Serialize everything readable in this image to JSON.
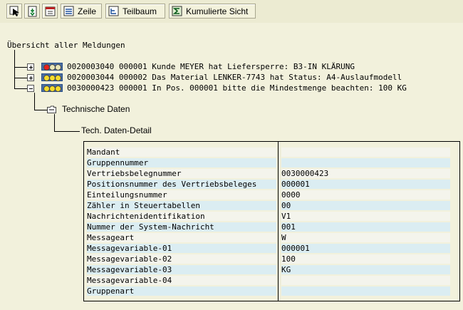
{
  "toolbar": {
    "buttons": [
      {
        "name": "select-icon"
      },
      {
        "name": "export-icon"
      },
      {
        "name": "window-icon"
      },
      {
        "label": "Zeile",
        "icon": "row-icon"
      },
      {
        "label": "Teilbaum",
        "icon": "subtree-icon"
      },
      {
        "label": "Kumulierte Sicht",
        "icon": "sigma-icon"
      }
    ]
  },
  "tree": {
    "root_label": "Übersicht aller Meldungen",
    "messages": [
      {
        "text": "0020003040 000001 Kunde MEYER hat Liefersperre: B3-IN KLÄRUNG",
        "status": "red"
      },
      {
        "text": "0020003044 000002 Das Material LENKER-7743 hat Status: A4-Auslaufmodell",
        "status": "yellow"
      },
      {
        "text": "0030000423 000001 In Pos. 000001 bitte die Mindestmenge beachten: 100 KG",
        "status": "yellow"
      }
    ],
    "tech_label": "Technische Daten",
    "tech_detail_label": "Tech. Daten-Detail"
  },
  "colors": {
    "light_box": "#4a6fa5",
    "light_red": "#e8201c",
    "light_yellow": "#f4dc2c",
    "light_off": "#e9e6b8"
  },
  "details": [
    {
      "key": "Mandant",
      "value": ""
    },
    {
      "key": "Gruppennummer",
      "value": ""
    },
    {
      "key": "Vertriebsbelegnummer",
      "value": "0030000423"
    },
    {
      "key": "Positionsnummer des Vertriebsbeleges",
      "value": "000001"
    },
    {
      "key": "Einteilungsnummer",
      "value": "0000"
    },
    {
      "key": "Zähler in Steuertabellen",
      "value": "00"
    },
    {
      "key": "Nachrichtenidentifikation",
      "value": "V1"
    },
    {
      "key": "Nummer der System-Nachricht",
      "value": "001"
    },
    {
      "key": "Messageart",
      "value": "W"
    },
    {
      "key": "Messagevariable-01",
      "value": "000001"
    },
    {
      "key": "Messagevariable-02",
      "value": "100"
    },
    {
      "key": "Messagevariable-03",
      "value": "KG"
    },
    {
      "key": "Messagevariable-04",
      "value": ""
    },
    {
      "key": "Gruppenart",
      "value": ""
    }
  ]
}
